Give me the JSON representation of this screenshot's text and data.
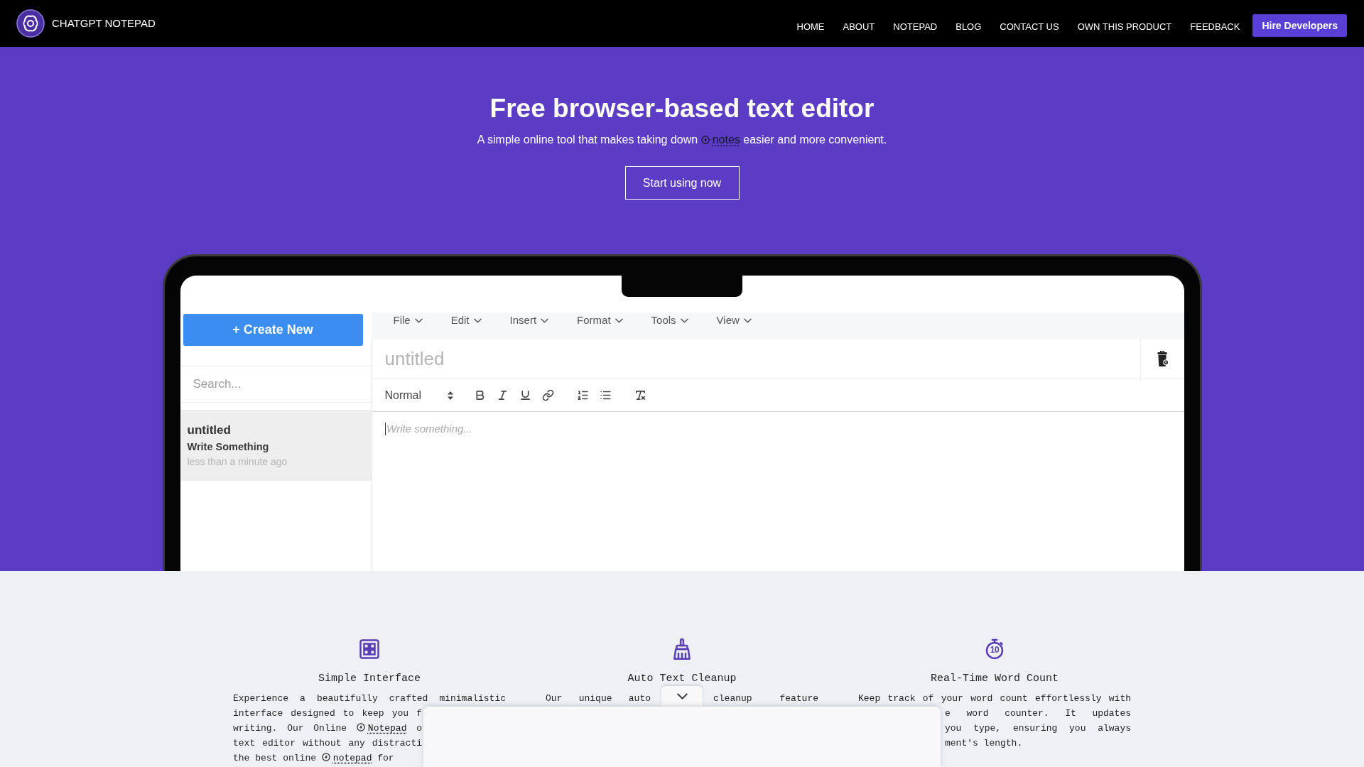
{
  "header": {
    "brand": "CHATGPT NOTEPAD",
    "nav": [
      "HOME",
      "ABOUT",
      "NOTEPAD",
      "BLOG",
      "CONTACT US",
      "OWN THIS PRODUCT",
      "FEEDBACK"
    ],
    "cta": "Hire Developers"
  },
  "hero": {
    "title": "Free browser-based text editor",
    "subtitle": {
      "before": "A simple online tool that makes taking down",
      "link": "notes",
      "after": "easier and more convenient."
    },
    "button": "Start using now"
  },
  "editor": {
    "create_button": "+ Create New",
    "search": {
      "placeholder": "Search..."
    },
    "notes": [
      {
        "title": "untitled",
        "preview": "Write Something",
        "time": "less than a minute ago",
        "selected": true
      }
    ],
    "menu": [
      "File",
      "Edit",
      "Insert",
      "Format",
      "Tools",
      "View"
    ],
    "title_field": {
      "placeholder": "untitled"
    },
    "format_select": {
      "value": "Normal"
    },
    "body": {
      "placeholder": "Write something..."
    }
  },
  "features": [
    {
      "title": "Simple Interface",
      "lines": [
        [
          {
            "text": "Experience a beautifully crafted minimalistic"
          }
        ],
        [
          {
            "text": "interface designed to keep you f"
          }
        ],
        [
          {
            "text": "writing. Our Online",
            "link": "Notepad",
            "after": "o"
          }
        ],
        [
          {
            "text": "text editor without any distracti"
          }
        ],
        [
          {
            "text": "the best online",
            "link": "notepad",
            "after": "for"
          }
        ]
      ]
    },
    {
      "title": "Auto Text Cleanup",
      "lines": [
        [
          {
            "text": "Our unique auto"
          },
          {
            "text": "cleanup feature"
          }
        ]
      ]
    },
    {
      "title": "Real-Time Word Count",
      "icon_text": "10",
      "lines": [
        [
          {
            "text": "Keep track of your word count effortlessly with"
          }
        ],
        [
          {
            "text": "e word counter. It updates"
          }
        ],
        [
          {
            "text": "you type, ensuring you always"
          }
        ],
        [
          {
            "text": "ment's length."
          }
        ]
      ]
    }
  ]
}
